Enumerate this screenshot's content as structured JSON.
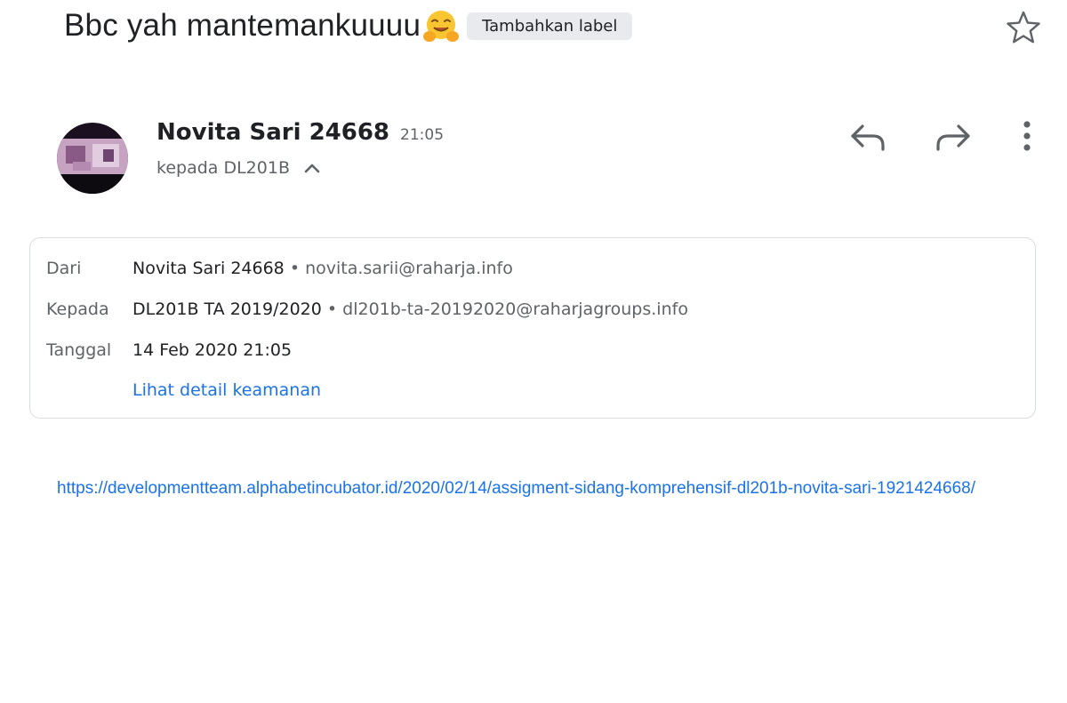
{
  "subject": {
    "text": "Bbc yah mantemankuuuu",
    "emoji": "hugging-face-icon",
    "label_chip": "Tambahkan label"
  },
  "sender": {
    "name": "Novita Sari 24668",
    "time": "21:05",
    "recipient_summary": "kepada DL201B"
  },
  "details": {
    "from_label": "Dari",
    "from_name": "Novita Sari 24668",
    "from_separator": " • ",
    "from_email": "novita.sarii@raharja.info",
    "to_label": "Kepada",
    "to_name": "DL201B TA 2019/2020",
    "to_separator": " • ",
    "to_email": "dl201b-ta-20192020@raharjagroups.info",
    "date_label": "Tanggal",
    "date_value": "14 Feb 2020 21:05",
    "security_link": "Lihat detail keamanan"
  },
  "body": {
    "link": "https://developmentteam.alphabetincubator.id/2020/02/14/assigment-sidang-komprehensif-dl201b-novita-sari-1921424668/"
  },
  "colors": {
    "link": "#1a73e8",
    "text": "#202124",
    "secondary": "#5f6368",
    "chip_bg": "#e8eaed",
    "border": "#dadce0"
  },
  "icons": {
    "star": "star-outline-icon",
    "reply": "reply-icon",
    "forward": "forward-icon",
    "more": "more-vert-icon",
    "chevron": "chevron-up-icon"
  }
}
